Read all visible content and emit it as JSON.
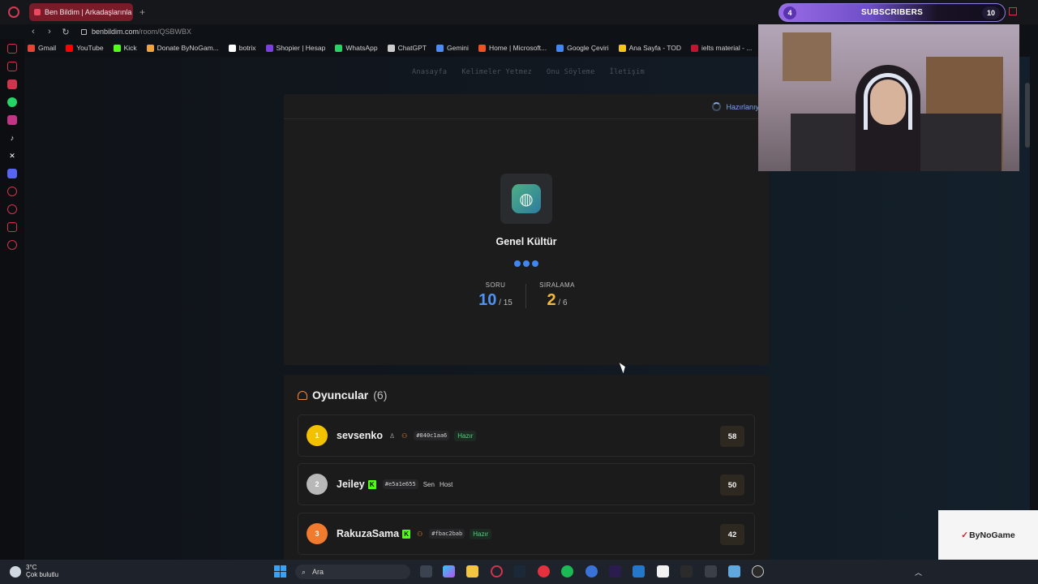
{
  "browser": {
    "tab_title": "Ben Bildim | Arkadaşlarınla",
    "url_domain": "benbildim.com",
    "url_path": "/room/QSBWBX",
    "bookmarks": [
      {
        "label": "Gmail",
        "color": "#e94335"
      },
      {
        "label": "YouTube",
        "color": "#ff0000"
      },
      {
        "label": "Kick",
        "color": "#53fc18"
      },
      {
        "label": "Donate ByNoGam...",
        "color": "#f0a23b"
      },
      {
        "label": "botrix",
        "color": "#ffffff"
      },
      {
        "label": "Shopier | Hesap",
        "color": "#7b3fe4"
      },
      {
        "label": "WhatsApp",
        "color": "#25d366"
      },
      {
        "label": "ChatGPT",
        "color": "#cccccc"
      },
      {
        "label": "Gemini",
        "color": "#4e8cf5"
      },
      {
        "label": "Home | Microsoft...",
        "color": "#f25022"
      },
      {
        "label": "Google Çeviri",
        "color": "#4285f4"
      },
      {
        "label": "Ana Sayfa - TOD",
        "color": "#f5c518"
      },
      {
        "label": "ielts material - ...",
        "color": "#c41230"
      }
    ]
  },
  "site": {
    "nav": [
      "Anasayfa",
      "Kelimeler Yetmez",
      "Onu Söyleme",
      "İletişim"
    ]
  },
  "game": {
    "status": "Hazırlanıyor",
    "category": "Genel Kültür",
    "question_label": "SORU",
    "question_current": "10",
    "question_total": "/ 15",
    "rank_label": "SIRALAMA",
    "rank_current": "2",
    "rank_total": "/ 6"
  },
  "players": {
    "title": "Oyuncular",
    "count": "(6)",
    "list": [
      {
        "rank": "1",
        "name": "sevsenko",
        "kick": false,
        "hash": "#840c1aa6",
        "tag1": "",
        "tag2": "Hazır",
        "score": "58",
        "color": "#f2c200"
      },
      {
        "rank": "2",
        "name": "Jeiley",
        "kick": true,
        "hash": "#e5a1e655",
        "tag1": "Sen",
        "tag2": "Host",
        "score": "50",
        "color": "#b8b8b8"
      },
      {
        "rank": "3",
        "name": "RakuzaSama",
        "kick": true,
        "hash": "#fbac2bab",
        "tag1": "",
        "tag2": "Hazır",
        "score": "42",
        "color": "#f07b2e"
      }
    ]
  },
  "overlay": {
    "sub_count": "4",
    "sub_title": "SUBSCRIBERS",
    "sub_goal": "10",
    "brand": "ByNoGame"
  },
  "taskbar": {
    "temp": "3°C",
    "weather": "Çok bulutlu",
    "search_label": "Ara"
  }
}
